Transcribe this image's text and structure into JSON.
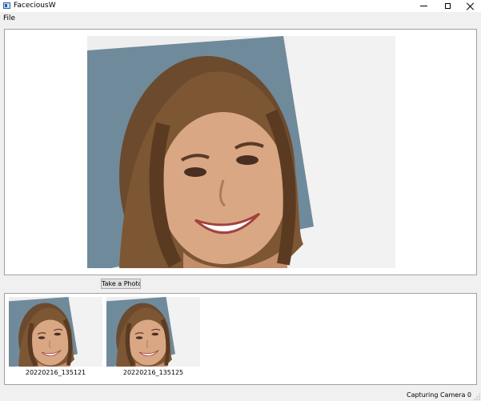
{
  "window": {
    "title": "FaceciousW",
    "icon": "app-window-icon"
  },
  "menubar": {
    "items": [
      "File"
    ]
  },
  "preview": {
    "image_description_icon": "camera-preview"
  },
  "actions": {
    "take_photo_label": "Take a Photo"
  },
  "gallery": {
    "items": [
      {
        "label": "20220216_135121"
      },
      {
        "label": "20220216_135125"
      }
    ]
  },
  "status": {
    "text": "Capturing Camera 0"
  },
  "colors": {
    "window_bg": "#f0f0f0",
    "panel_bg": "#ffffff",
    "panel_border": "#a0a0a0",
    "button_bg": "#e1e1e1",
    "button_border": "#adadad"
  }
}
